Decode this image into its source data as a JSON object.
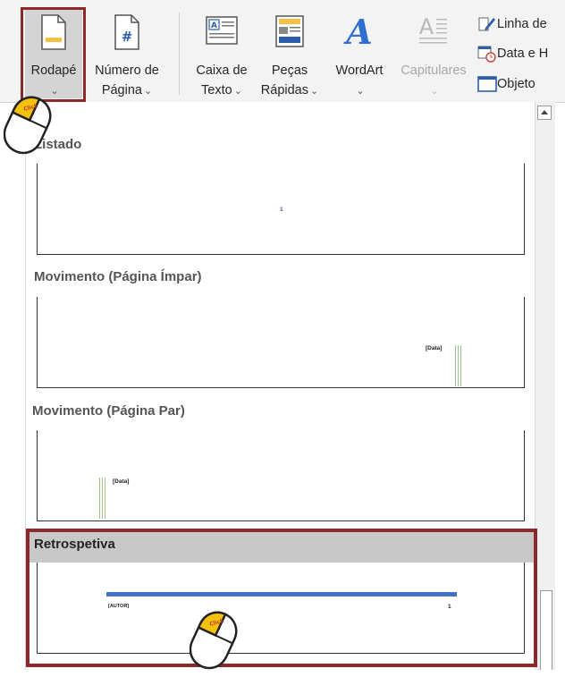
{
  "ribbon": {
    "footer_button": {
      "label": "Rodapé",
      "caret": "⌄"
    },
    "page_number_button": {
      "label_line1": "Número de",
      "label_line2": "Página",
      "caret": "⌄"
    },
    "textbox_button": {
      "label_line1": "Caixa de",
      "label_line2": "Texto",
      "caret": "⌄"
    },
    "quickparts_button": {
      "label_line1": "Peças",
      "label_line2": "Rápidas",
      "caret": "⌄"
    },
    "wordart_button": {
      "label": "WordArt",
      "caret": "⌄"
    },
    "dropcap_button": {
      "label": "Capitulares",
      "caret": "⌄"
    },
    "signature_line": {
      "label": "Linha de"
    },
    "date_time": {
      "label": "Data e H"
    },
    "object": {
      "label": "Objeto"
    }
  },
  "gallery": {
    "sections": [
      {
        "title": "Listado",
        "page_number": "1"
      },
      {
        "title": "Movimento (Página Ímpar)",
        "placeholder": "[Data]"
      },
      {
        "title": "Movimento (Página Par)",
        "placeholder": "[Data]"
      },
      {
        "title": "Retrospetiva",
        "author_placeholder": "[AUTOR]",
        "page_number": "1"
      }
    ]
  },
  "cursor_badge": "Click",
  "colors": {
    "highlight": "#8b2a2a",
    "accent_blue": "#4472c4",
    "green": "#9cc48a"
  }
}
